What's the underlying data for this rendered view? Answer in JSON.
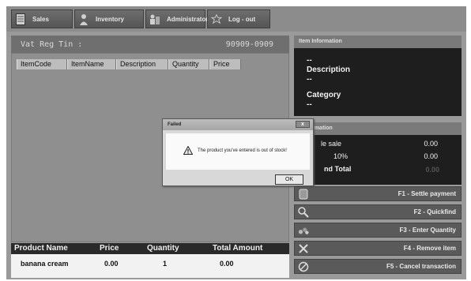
{
  "nav": {
    "items": [
      {
        "label": "Sales",
        "icon": "document-icon"
      },
      {
        "label": "Inventory",
        "icon": "person-icon"
      },
      {
        "label": "Administrator",
        "icon": "admin-icon"
      },
      {
        "label": "Log - out",
        "icon": "exit-icon"
      }
    ]
  },
  "header": {
    "vat_label": "Vat Reg Tin :",
    "vat_value": "90909-0909"
  },
  "grid": {
    "columns": [
      "ItemCode",
      "ItemName",
      "Description",
      "Quantity",
      "Price"
    ]
  },
  "cart": {
    "columns": [
      "Product Name",
      "Price",
      "Quantity",
      "Total Amount"
    ],
    "rows": [
      {
        "product": "banana cream",
        "price": "0.00",
        "quantity": "1",
        "total": "0.00"
      }
    ]
  },
  "item_info": {
    "title": "Item Information",
    "name_value": "--",
    "description_label": "Description",
    "description_value": "--",
    "category_label": "Category",
    "category_value": "--"
  },
  "sale_info": {
    "title": "t Information",
    "sale_label": "le sale",
    "sale_value": "0.00",
    "vat_label": "10%",
    "vat_value": "0.00",
    "grand_label": "nd Total",
    "grand_value": "0.00"
  },
  "function_buttons": [
    {
      "label": "F1 - Settle payment",
      "icon": "cash-icon"
    },
    {
      "label": "F2 - Quickfind",
      "icon": "magnifier-icon"
    },
    {
      "label": "F3 - Enter Quantity",
      "icon": "quantity-icon"
    },
    {
      "label": "F4 - Remove item",
      "icon": "remove-icon"
    },
    {
      "label": "F5 - Cancel transaction",
      "icon": "cancel-icon"
    }
  ],
  "dialog": {
    "title": "Failed",
    "message": "The product you've entered is out of stock!",
    "ok_label": "OK",
    "close_label": "x"
  }
}
